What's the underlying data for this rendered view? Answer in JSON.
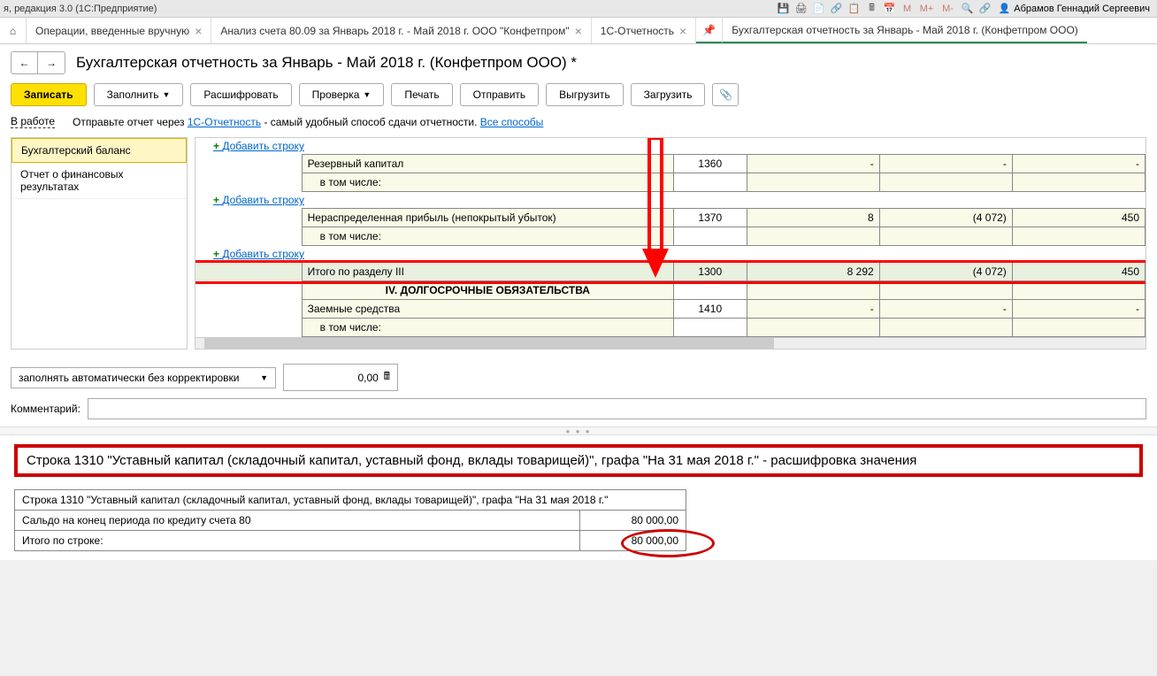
{
  "titlebar": {
    "left": "я, редакция 3.0  (1С:Предприятие)",
    "user": "Абрамов Геннадий Сергеевич",
    "m_labels": [
      "M",
      "M+",
      "M-"
    ]
  },
  "tabs": [
    {
      "label": "Операции, введенные вручную"
    },
    {
      "label": "Анализ счета 80.09 за Январь 2018 г. - Май 2018 г. ООО \"Конфетпром\""
    },
    {
      "label": "1С-Отчетность"
    },
    {
      "label": "Бухгалтерская отчетность за Январь - Май 2018 г. (Конфетпром ООО)"
    }
  ],
  "page_title": "Бухгалтерская отчетность за Январь - Май 2018 г. (Конфетпром ООО) *",
  "toolbar": {
    "write": "Записать",
    "fill": "Заполнить",
    "decode": "Расшифровать",
    "check": "Проверка",
    "print": "Печать",
    "send": "Отправить",
    "upload": "Выгрузить",
    "download": "Загрузить"
  },
  "info": {
    "status": "В работе",
    "hint_pre": "Отправьте отчет через ",
    "hint_link": "1С-Отчетность",
    "hint_post": " - самый удобный способ сдачи отчетности. ",
    "all_ways": "Все способы"
  },
  "sidebar": {
    "items": [
      "Бухгалтерский баланс",
      "Отчет о финансовых результатах"
    ]
  },
  "add_row": "Добавить строку",
  "rows": {
    "reserve": "Резервный капитал",
    "reserve_code": "1360",
    "vtom": "в том числе:",
    "profit": "Нераспределенная прибыль (непокрытый убыток)",
    "profit_code": "1370",
    "profit_v2": "(4 072)",
    "profit_v3": "450",
    "total3": "Итого по разделу III",
    "total3_code": "1300",
    "total3_v1": "8 292",
    "total3_v2": "(4 072)",
    "total3_v3": "450",
    "section4": "IV. ДОЛГОСРОЧНЫЕ ОБЯЗАТЕЛЬСТВА",
    "loan": "Заемные средства",
    "loan_code": "1410",
    "vtom2": "в том числе:"
  },
  "bottom": {
    "mode": "заполнять автоматически без корректировки",
    "num": "0,00",
    "comment_label": "Комментарий:"
  },
  "detail": {
    "title": "Строка 1310 \"Уставный капитал (складочный капитал, уставный фонд, вклады товарищей)\", графа \"На 31 мая 2018 г.\" - расшифровка значения",
    "row1": "Строка 1310 \"Уставный капитал (складочный капитал, уставный фонд, вклады товарищей)\", графа \"На 31 мая 2018 г.\"",
    "row2": "Сальдо на конец периода по кредиту счета 80",
    "row2_val": "80 000,00",
    "row3": "Итого по строке:",
    "row3_val": "80 000,00"
  }
}
